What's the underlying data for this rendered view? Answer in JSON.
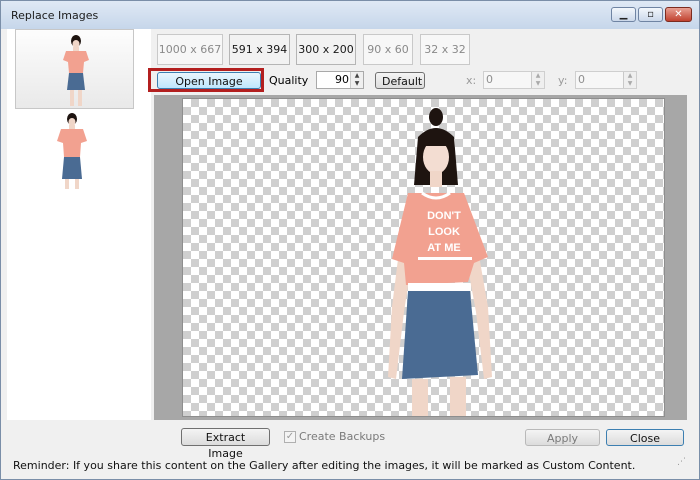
{
  "window": {
    "title": "Replace Images"
  },
  "sizes": [
    {
      "label": "1000 x 667",
      "active": false
    },
    {
      "label": "591 x 394",
      "active": true
    },
    {
      "label": "300 x 200",
      "active": true
    },
    {
      "label": "90 x 60",
      "active": false
    },
    {
      "label": "32 x 32",
      "active": false
    }
  ],
  "toolbar": {
    "open_image": "Open Image",
    "quality_label": "Quality",
    "quality_value": "90",
    "default": "Default",
    "x_label": "x:",
    "x_value": "0",
    "y_label": "y:",
    "y_value": "0"
  },
  "preview": {
    "shirt_lines": [
      "DON'T",
      "LOOK",
      "AT ME"
    ]
  },
  "footer": {
    "extract_image": "Extract Image",
    "create_backups": "Create Backups",
    "create_backups_checked": true,
    "apply": "Apply",
    "close": "Close",
    "reminder": "Reminder: If you share this content on the Gallery after editing the images, it will be marked as Custom Content."
  },
  "colors": {
    "highlight": "#b31f1f",
    "shirt": "#f2a190",
    "skirt": "#4a6b93",
    "hair": "#1e1410"
  },
  "icons": {
    "minimize": "minimize-icon",
    "maximize": "maximize-icon",
    "close": "close-icon"
  }
}
